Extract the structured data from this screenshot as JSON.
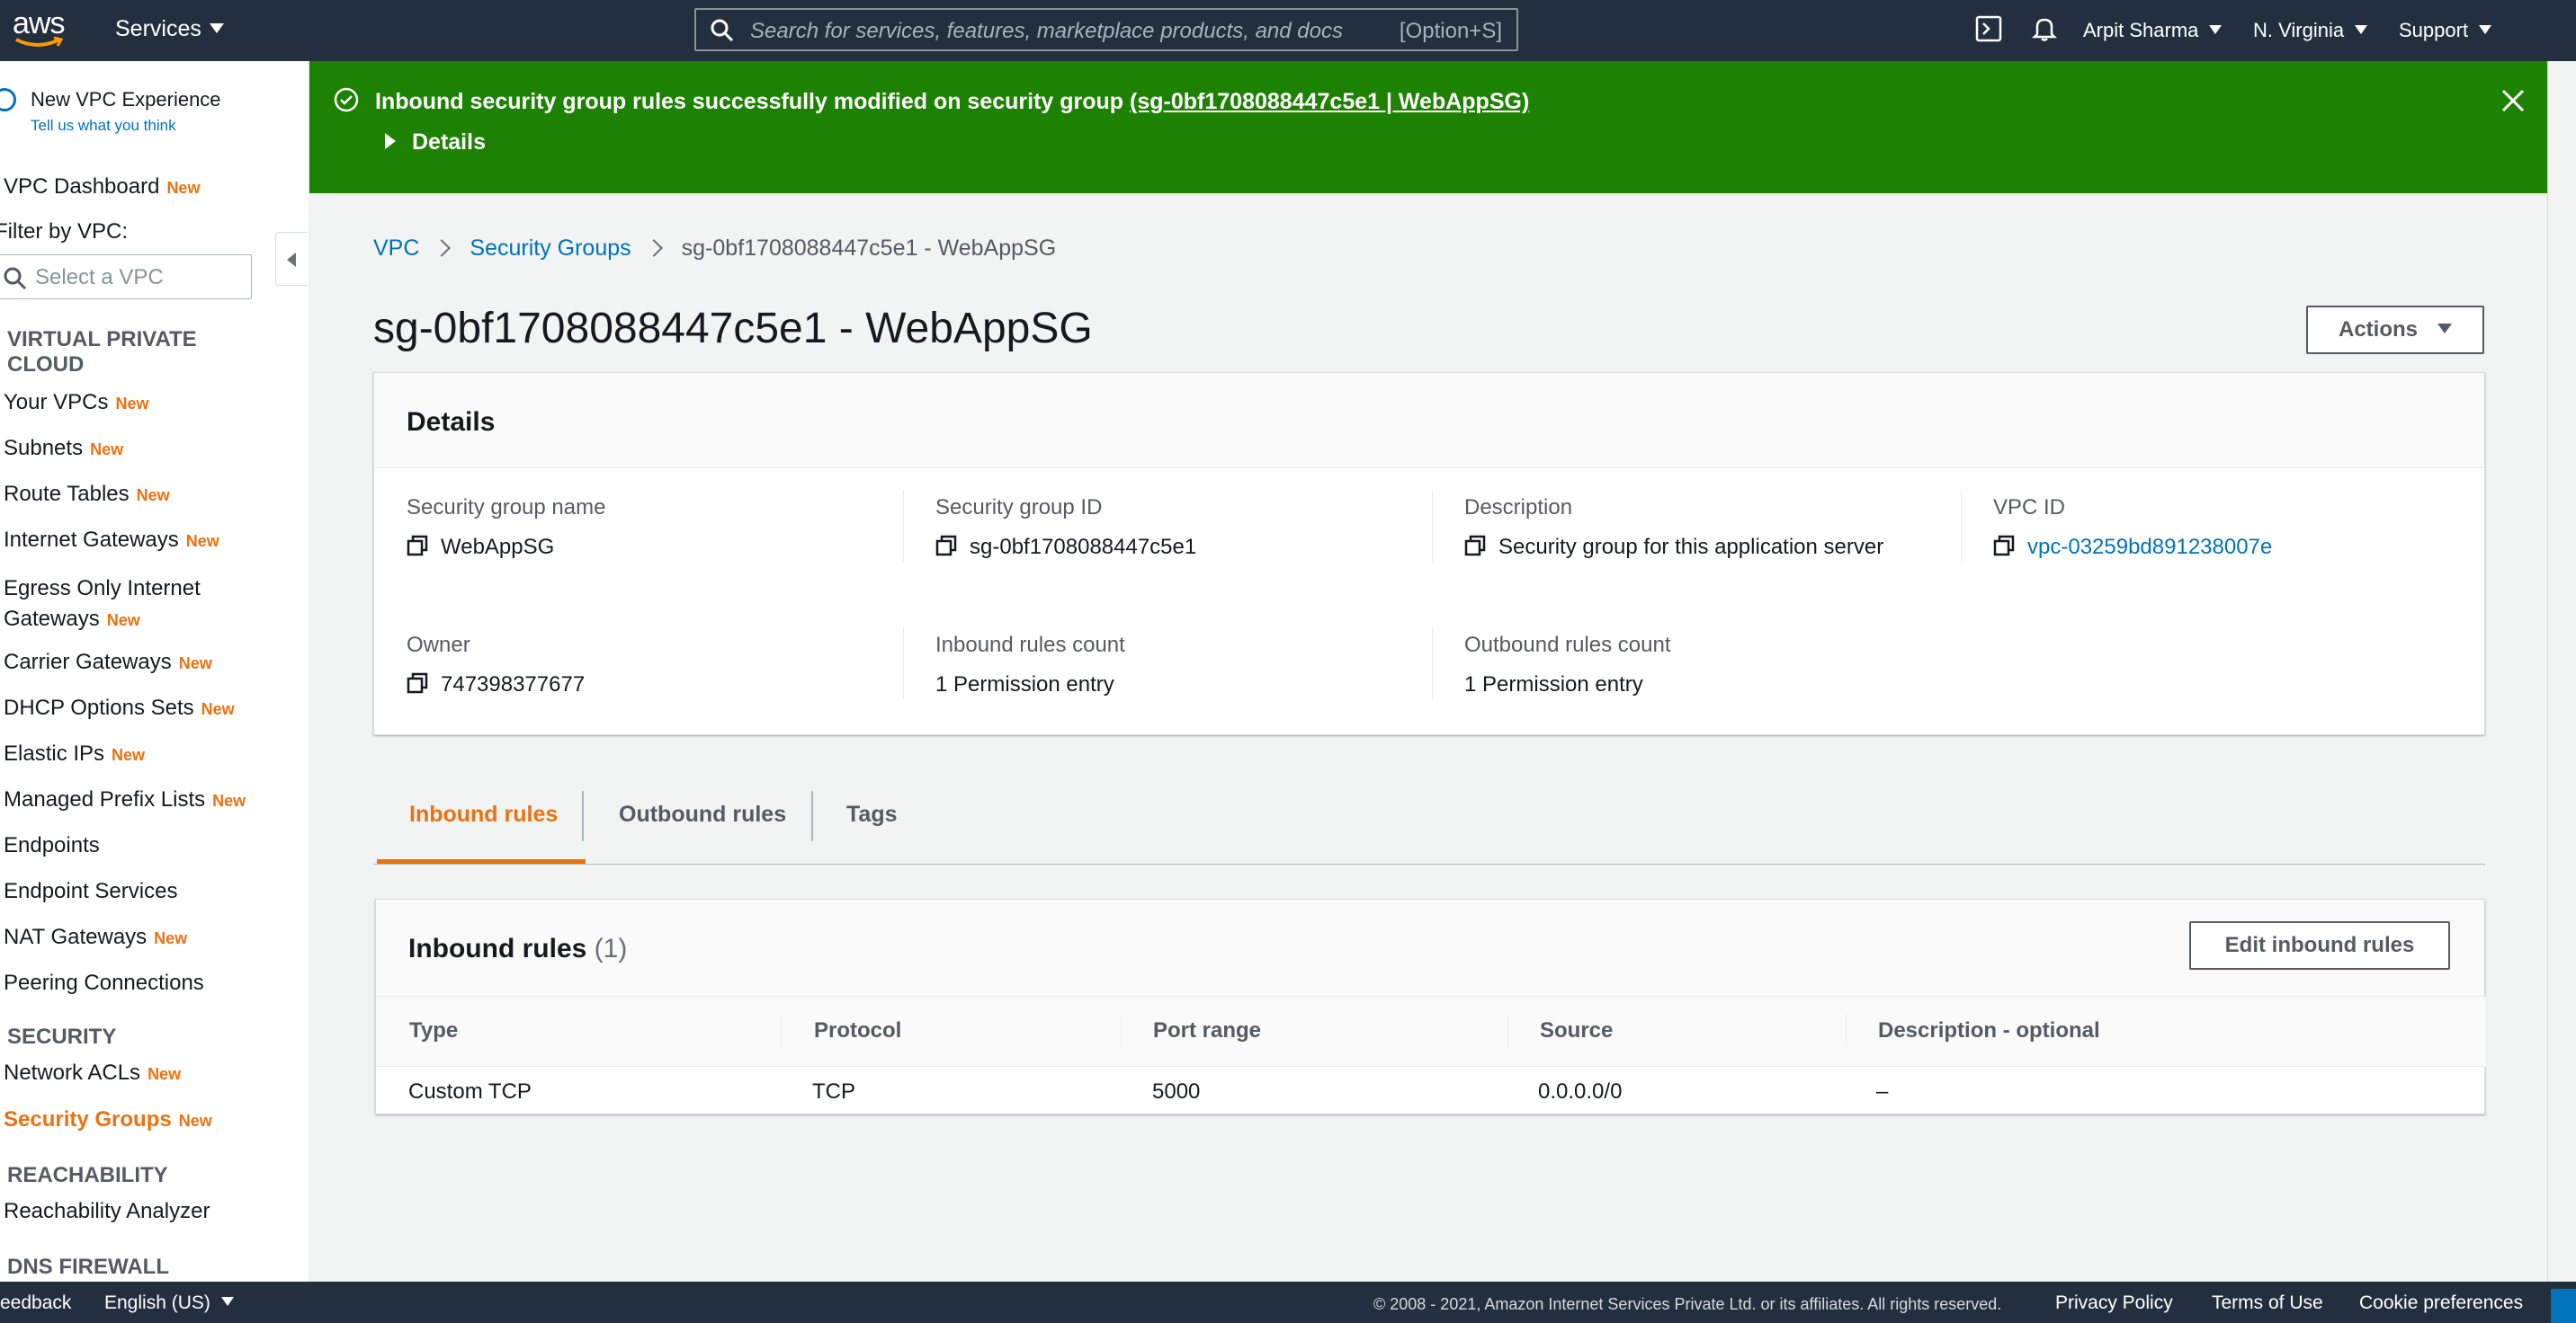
{
  "topnav": {
    "logo": "aws",
    "services": "Services",
    "search_placeholder": "Search for services, features, marketplace products, and docs",
    "search_hint": "[Option+S]",
    "user": "Arpit Sharma",
    "region": "N. Virginia",
    "support": "Support",
    "icons": [
      "cloudshell-icon",
      "bell-icon"
    ]
  },
  "sidebar": {
    "new_vpc_experience": "New VPC Experience",
    "tell_us": "Tell us what you think",
    "new_badge": "New",
    "dashboard": "VPC Dashboard",
    "filter_label": "Filter by VPC:",
    "vpc_select_placeholder": "Select a VPC",
    "section_vpc_line1": "VIRTUAL PRIVATE",
    "section_vpc_line2": "CLOUD",
    "items": [
      {
        "label": "Your VPCs",
        "new": true
      },
      {
        "label": "Subnets",
        "new": true
      },
      {
        "label": "Route Tables",
        "new": true
      },
      {
        "label": "Internet Gateways",
        "new": true
      },
      {
        "label": "Egress Only Internet",
        "label2": "Gateways",
        "new": true
      },
      {
        "label": "Carrier Gateways",
        "new": true
      },
      {
        "label": "DHCP Options Sets",
        "new": true
      },
      {
        "label": "Elastic IPs",
        "new": true
      },
      {
        "label": "Managed Prefix Lists",
        "new": true
      },
      {
        "label": "Endpoints",
        "new": false
      },
      {
        "label": "Endpoint Services",
        "new": false
      },
      {
        "label": "NAT Gateways",
        "new": true
      },
      {
        "label": "Peering Connections",
        "new": false
      }
    ],
    "section_security": "SECURITY",
    "security_items": [
      {
        "label": "Network ACLs",
        "new": true
      },
      {
        "label": "Security Groups",
        "new": true,
        "active": true
      }
    ],
    "section_reachability": "REACHABILITY",
    "reachability_items": [
      {
        "label": "Reachability Analyzer"
      }
    ],
    "section_dns": "DNS FIREWALL"
  },
  "flash": {
    "message": "Inbound security group rules successfully modified on security group",
    "link": "(sg-0bf1708088447c5e1 | WebAppSG)",
    "details": "Details",
    "color": "#1d8102"
  },
  "breadcrumb": [
    "VPC",
    "Security Groups",
    "sg-0bf1708088447c5e1 - WebAppSG"
  ],
  "page_title": "sg-0bf1708088447c5e1 - WebAppSG",
  "actions_label": "Actions",
  "details": {
    "title": "Details",
    "fields": [
      {
        "label": "Security group name",
        "value": "WebAppSG"
      },
      {
        "label": "Security group ID",
        "value": "sg-0bf1708088447c5e1"
      },
      {
        "label": "Description",
        "value": "Security group for this application server"
      },
      {
        "label": "VPC ID",
        "value": "vpc-03259bd891238007e"
      },
      {
        "label": "Owner",
        "value": "747398377677"
      },
      {
        "label": "Inbound rules count",
        "value": "1 Permission entry"
      },
      {
        "label": "Outbound rules count",
        "value": "1 Permission entry"
      }
    ]
  },
  "tabs": [
    "Inbound rules",
    "Outbound rules",
    "Tags"
  ],
  "inbound": {
    "title": "Inbound rules",
    "count": "(1)",
    "edit_label": "Edit inbound rules",
    "columns": [
      "Type",
      "Protocol",
      "Port range",
      "Source",
      "Description - optional"
    ],
    "rows": [
      [
        "Custom TCP",
        "TCP",
        "5000",
        "0.0.0.0/0",
        "–"
      ]
    ]
  },
  "footer": {
    "feedback": "eedback",
    "language": "English (US)",
    "copyright": "© 2008 - 2021, Amazon Internet Services Private Ltd. or its affiliates. All rights reserved.",
    "privacy": "Privacy Policy",
    "terms": "Terms of Use",
    "cookies": "Cookie preferences"
  },
  "colors": {
    "nav_bg": "#232f3e",
    "accent_orange": "#ec7211",
    "link_blue": "#0073bb",
    "success_green": "#1d8102"
  }
}
